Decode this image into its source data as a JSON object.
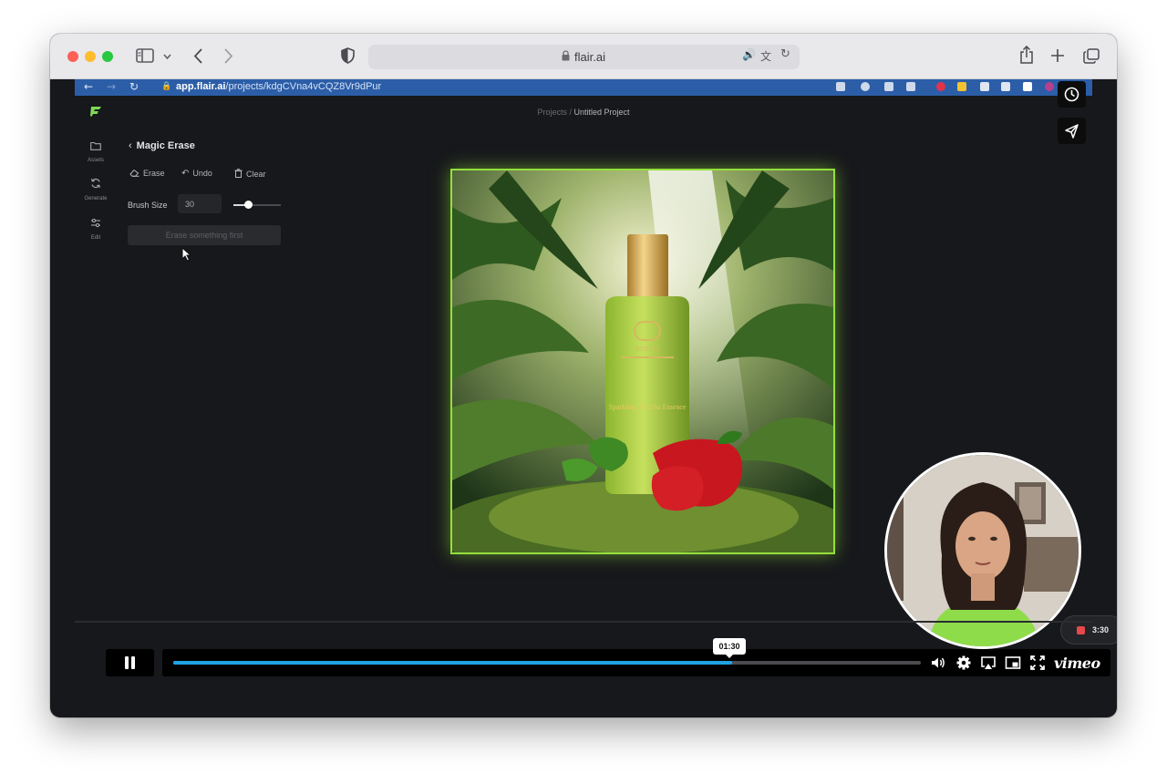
{
  "browser": {
    "url_display": "flair.ai"
  },
  "recorded_browser": {
    "url_host": "app.flair.ai",
    "url_path": "/projects/kdgCVna4vCQZ8Vr9dPur"
  },
  "app": {
    "breadcrumb_root": "Projects",
    "breadcrumb_sep": " / ",
    "breadcrumb_current": "Untitled Project",
    "rail": [
      {
        "label": "Assets",
        "icon": "folder-icon"
      },
      {
        "label": "Generate",
        "icon": "refresh-icon"
      },
      {
        "label": "Edit",
        "icon": "sliders-icon"
      }
    ],
    "panel": {
      "back_symbol": "‹",
      "title": "Magic Erase",
      "tools": [
        {
          "label": "Erase",
          "icon": "eraser-icon"
        },
        {
          "label": "Undo",
          "icon": "undo-icon"
        },
        {
          "label": "Clear",
          "icon": "trash-icon"
        }
      ],
      "brush_label": "Brush Size",
      "brush_value": "30",
      "brush_slider_fraction": 0.3,
      "erase_button": "Erase something first"
    }
  },
  "product_image": {
    "brand_text": "TATCHA",
    "product_name": "Sparkling Matcha Essence"
  },
  "recording": {
    "elapsed": "3:30",
    "record_color": "#e5484d"
  },
  "player": {
    "tooltip_time": "01:30",
    "progress_fraction": 0.748,
    "brand": "vimeo",
    "accent": "#1fa3e4"
  }
}
